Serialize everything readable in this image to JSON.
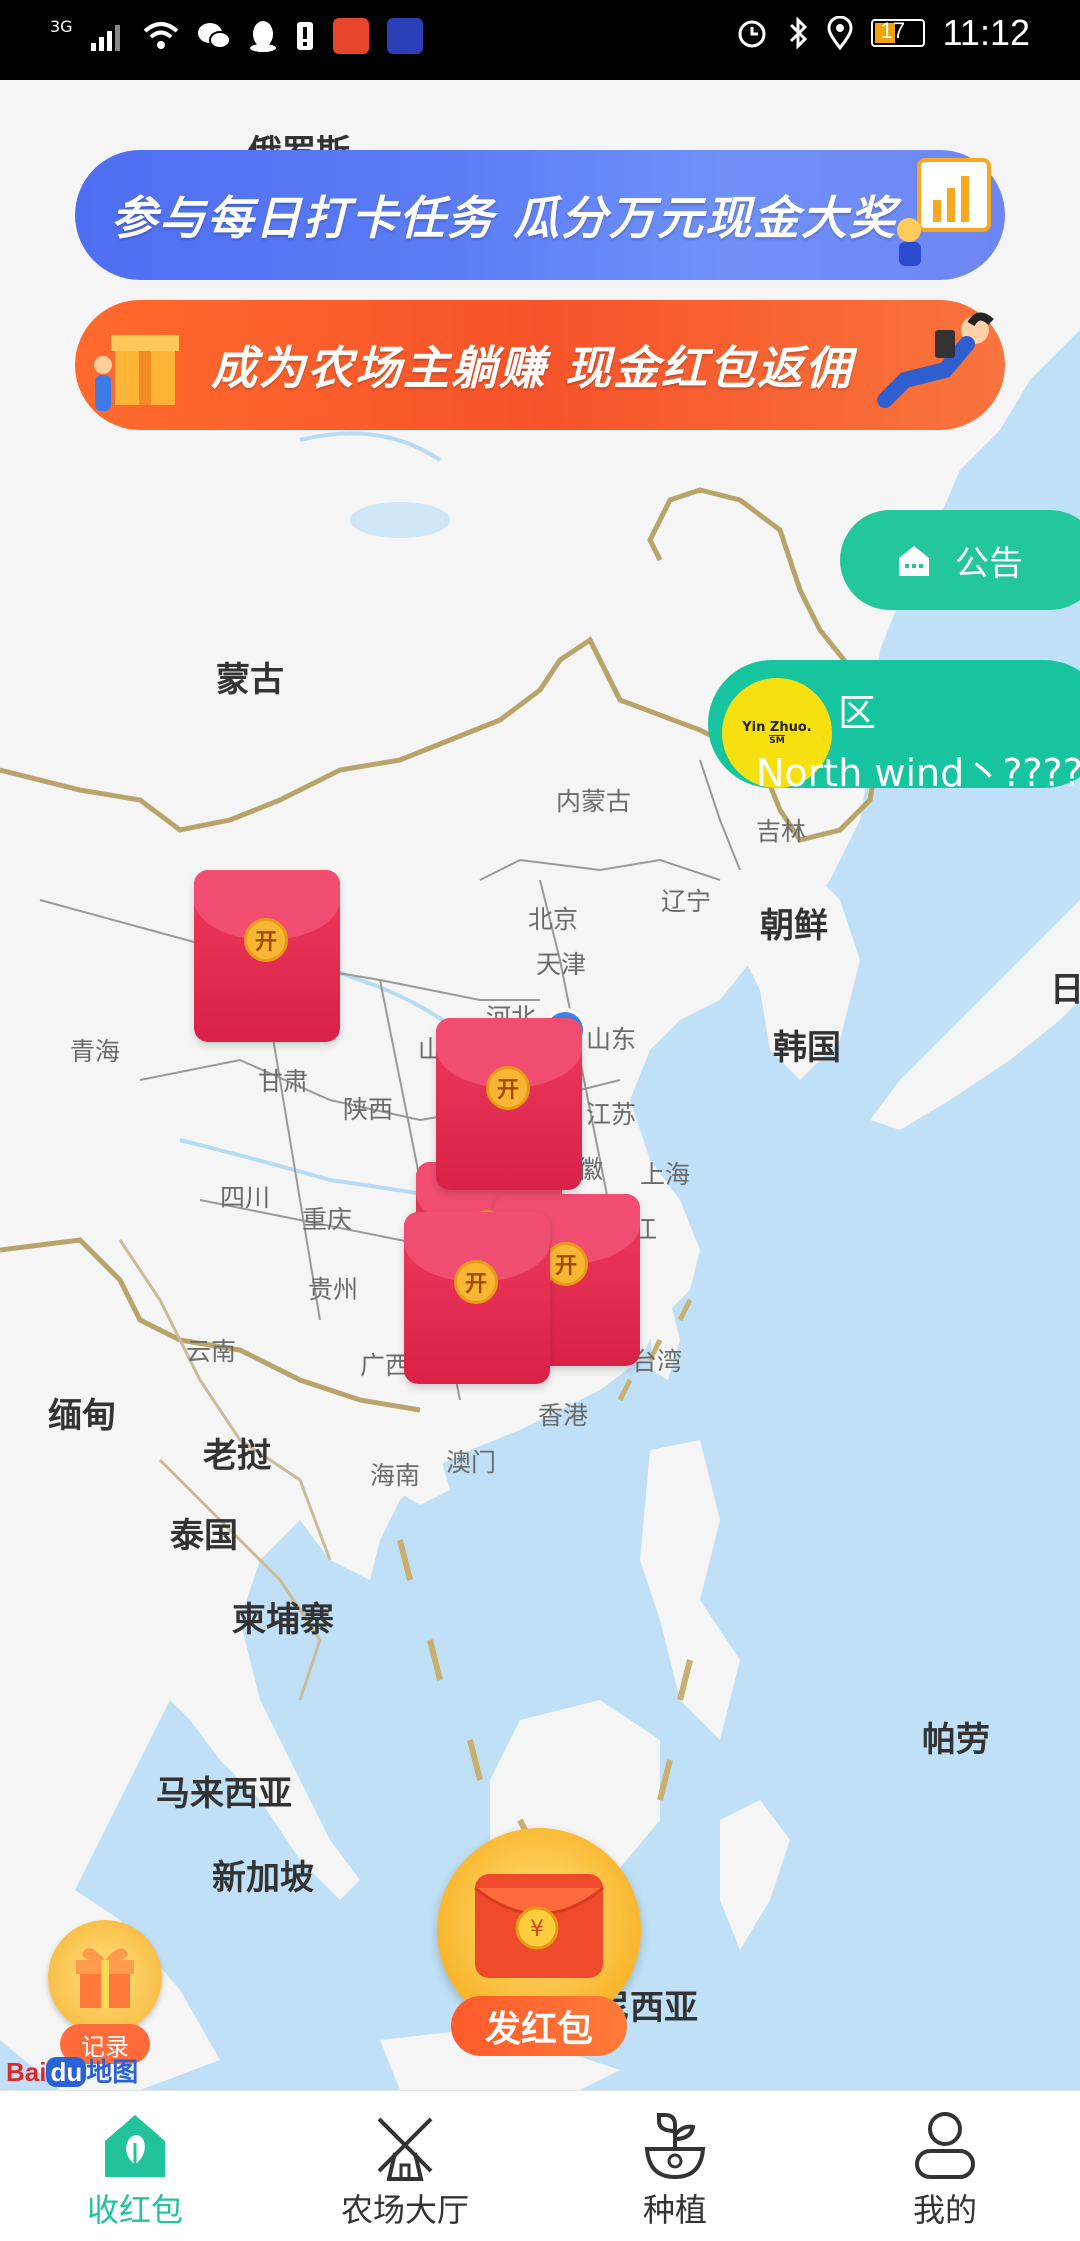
{
  "status_bar": {
    "network": "3G",
    "time": "11:12",
    "battery": "17",
    "icons": [
      "signal-icon",
      "wifi-icon",
      "wechat-icon",
      "qq-icon",
      "alert-icon",
      "app-icon-1",
      "app-icon-2",
      "alarm-icon",
      "bluetooth-icon",
      "location-icon",
      "battery-icon"
    ]
  },
  "banners": {
    "daily_checkin": "参与每日打卡任务 瓜分万元现金大奖",
    "farm_owner": "成为农场主躺赚 现金红包返佣"
  },
  "notice_button": "公告",
  "region_panel": {
    "avatar_text_1": "Yin Zhuo.",
    "avatar_text_2": "SM",
    "region_label": "区",
    "user_name": "North wind丶????"
  },
  "map_labels": {
    "russia": "俄罗斯",
    "mongolia": "蒙古",
    "inner_mongolia": "内蒙古",
    "jilin": "吉林",
    "liaoning": "辽宁",
    "north_korea": "朝鲜",
    "beijing": "北京",
    "tianjin": "天津",
    "hebei": "河北",
    "shandong": "山东",
    "shanxi": "山",
    "south_korea": "韩国",
    "japan": "日",
    "qinghai": "青海",
    "gansu": "甘肃",
    "shaanxi": "陕西",
    "jiangsu": "江苏",
    "anhui": "徽",
    "shanghai": "上海",
    "sichuan": "四川",
    "chongqing": "重庆",
    "zhejiang": "江",
    "guizhou": "贵州",
    "yunnan": "云南",
    "guangxi": "广西",
    "taiwan": "台湾",
    "hongkong": "香港",
    "macau": "澳门",
    "hainan": "海南",
    "myanmar": "缅甸",
    "laos": "老挝",
    "thailand": "泰国",
    "cambodia": "柬埔寨",
    "palau": "帕劳",
    "malaysia": "马来西亚",
    "singapore": "新加坡",
    "indonesia": "尼西亚"
  },
  "envelope_label": "开",
  "send_button": "发红包",
  "record_button": "记录",
  "map_logo": {
    "bai": "Bai",
    "du": "du",
    "map": "地图"
  },
  "tabs": [
    {
      "label": "收红包",
      "active": true
    },
    {
      "label": "农场大厅",
      "active": false
    },
    {
      "label": "种植",
      "active": false
    },
    {
      "label": "我的",
      "active": false
    }
  ],
  "colors": {
    "accent": "#22c29a",
    "envelope_red": "#e0284f",
    "sea": "#bfe0f6",
    "land": "#f5f5f5"
  }
}
